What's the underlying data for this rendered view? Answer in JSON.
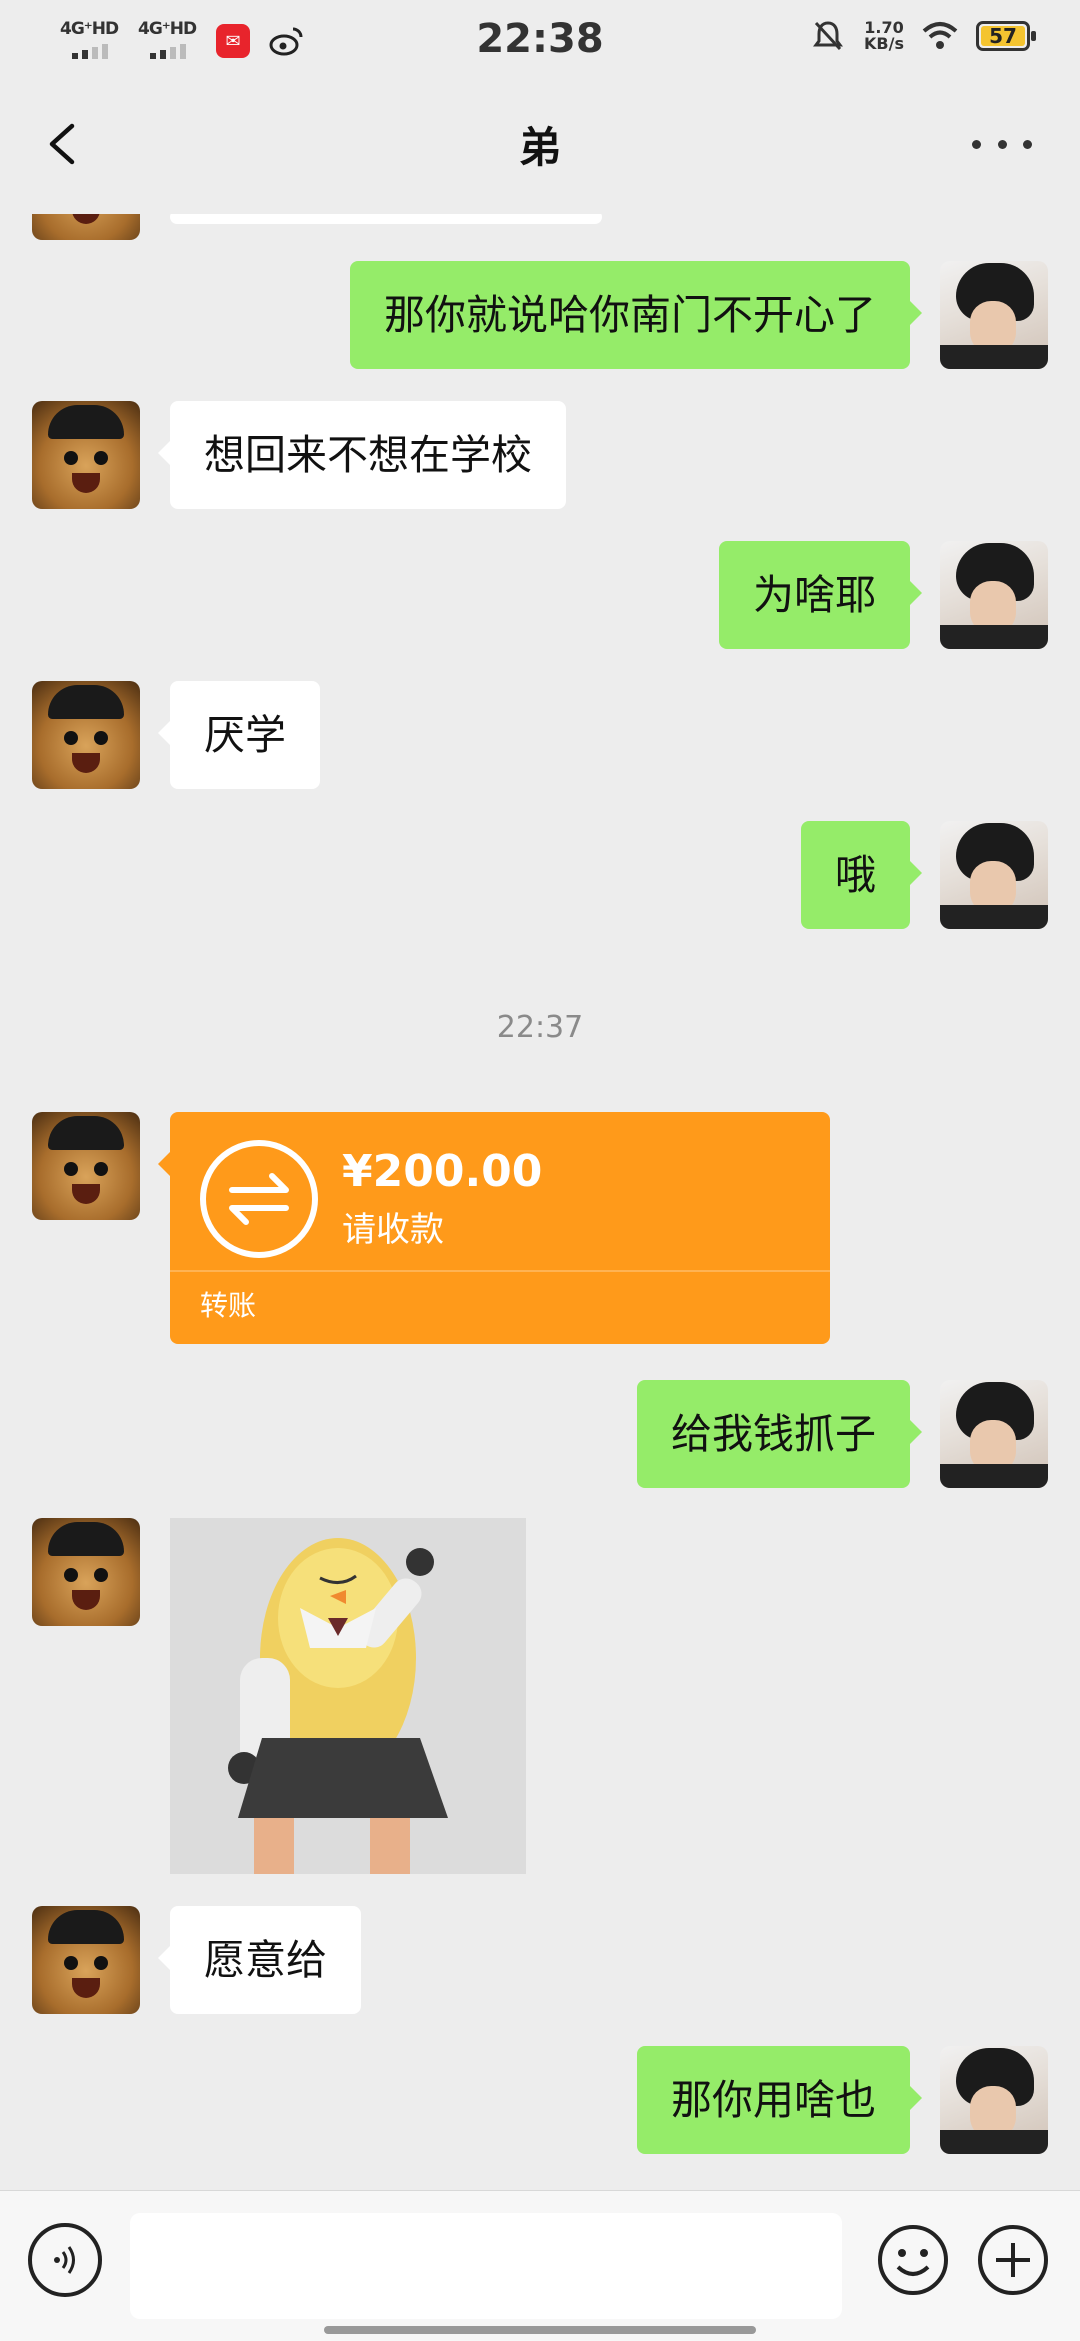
{
  "status_bar": {
    "network1": "4G⁺HD",
    "network2": "4G⁺HD",
    "time": "22:38",
    "speed_value": "1.70",
    "speed_unit": "KB/s",
    "battery": "57",
    "battery_color": "#f4c430"
  },
  "header": {
    "title": "弟"
  },
  "messages": [
    {
      "side": "out",
      "text": "那你就说哈你南门不开心了"
    },
    {
      "side": "in",
      "text": "想回来不想在学校"
    },
    {
      "side": "out",
      "text": "为啥耶"
    },
    {
      "side": "in",
      "text": "厌学"
    },
    {
      "side": "out",
      "text": "哦"
    },
    {
      "side": "out",
      "text": "给我钱抓子"
    },
    {
      "side": "in",
      "text": "愿意给"
    },
    {
      "side": "out",
      "text": "那你用啥也"
    }
  ],
  "timestamp": "22:37",
  "transfer": {
    "amount": "¥200.00",
    "status": "请收款",
    "label": "转账",
    "color": "#ff9a1a"
  },
  "input_bar": {
    "placeholder": ""
  },
  "colors": {
    "out_bubble": "#95ec69",
    "in_bubble": "#ffffff",
    "background": "#ededed"
  }
}
